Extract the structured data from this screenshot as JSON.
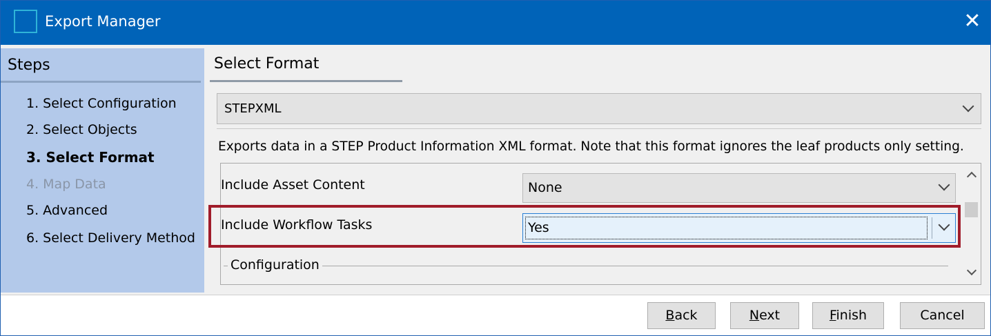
{
  "window": {
    "title": "Export Manager",
    "close_glyph": "✕"
  },
  "steps": {
    "header": "Steps",
    "items": [
      {
        "label": "1. Select Configuration",
        "state": "normal"
      },
      {
        "label": "2. Select Objects",
        "state": "normal"
      },
      {
        "label": "3. Select Format",
        "state": "current"
      },
      {
        "label": "4. Map Data",
        "state": "disabled"
      },
      {
        "label": "5. Advanced",
        "state": "normal"
      },
      {
        "label": "6. Select Delivery Method",
        "state": "normal"
      }
    ]
  },
  "main": {
    "title": "Select Format",
    "format_select": {
      "value": "STEPXML"
    },
    "description": "Exports data in a STEP Product Information XML format. Note that this format ignores the leaf products only setting.",
    "options": [
      {
        "label": "Include Asset Content",
        "value": "None"
      },
      {
        "label": "Include Workflow Tasks",
        "value": "Yes"
      }
    ],
    "group_label": "Configuration"
  },
  "buttons": {
    "back": {
      "mnemonic": "B",
      "rest": "ack"
    },
    "next": {
      "mnemonic": "N",
      "rest": "ext"
    },
    "finish": {
      "mnemonic": "F",
      "rest": "inish"
    },
    "cancel": {
      "label": "Cancel"
    }
  },
  "colors": {
    "titlebar": "#0063b8",
    "steps_panel": "#b3c9ea",
    "highlight": "#a01c2a"
  }
}
